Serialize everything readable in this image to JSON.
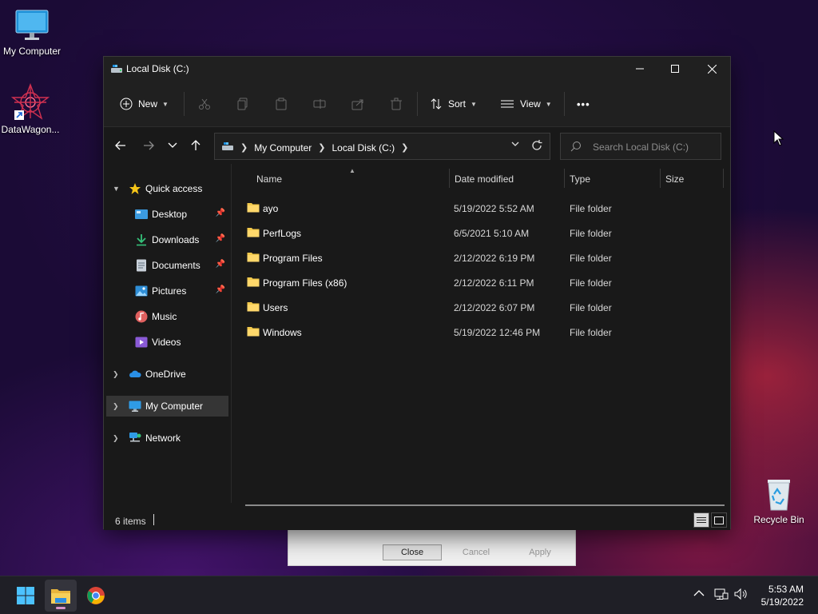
{
  "desktop": {
    "icons": [
      {
        "label": "My Computer"
      },
      {
        "label": "DataWagon..."
      },
      {
        "label": "Recycle Bin"
      }
    ]
  },
  "back_dialog": {
    "close_label": "Close",
    "cancel_label": "Cancel",
    "apply_label": "Apply"
  },
  "window": {
    "title": "Local Disk (C:)",
    "toolbar": {
      "new_label": "New",
      "sort_label": "Sort",
      "view_label": "View",
      "more_label": "•••"
    },
    "address": {
      "crumbs": [
        "My Computer",
        "Local Disk (C:)"
      ]
    },
    "search": {
      "placeholder": "Search Local Disk (C:)"
    },
    "nav": {
      "quick_access": "Quick access",
      "items": [
        {
          "label": "Desktop"
        },
        {
          "label": "Downloads"
        },
        {
          "label": "Documents"
        },
        {
          "label": "Pictures"
        },
        {
          "label": "Music"
        },
        {
          "label": "Videos"
        }
      ],
      "onedrive": "OneDrive",
      "my_computer": "My Computer",
      "network": "Network"
    },
    "columns": {
      "name": "Name",
      "date": "Date modified",
      "type": "Type",
      "size": "Size"
    },
    "files": [
      {
        "name": "ayo",
        "date": "5/19/2022 5:52 AM",
        "type": "File folder"
      },
      {
        "name": "PerfLogs",
        "date": "6/5/2021 5:10 AM",
        "type": "File folder"
      },
      {
        "name": "Program Files",
        "date": "2/12/2022 6:19 PM",
        "type": "File folder"
      },
      {
        "name": "Program Files (x86)",
        "date": "2/12/2022 6:11 PM",
        "type": "File folder"
      },
      {
        "name": "Users",
        "date": "2/12/2022 6:07 PM",
        "type": "File folder"
      },
      {
        "name": "Windows",
        "date": "5/19/2022 12:46 PM",
        "type": "File folder"
      }
    ],
    "status": {
      "count": "6 items"
    }
  },
  "taskbar": {
    "time": "5:53 AM",
    "date": "5/19/2022"
  },
  "colors": {
    "folder": "#f2c94c",
    "window_bg": "#191919",
    "selected_nav": "#353535",
    "win_blue": "#4cc2ff"
  }
}
